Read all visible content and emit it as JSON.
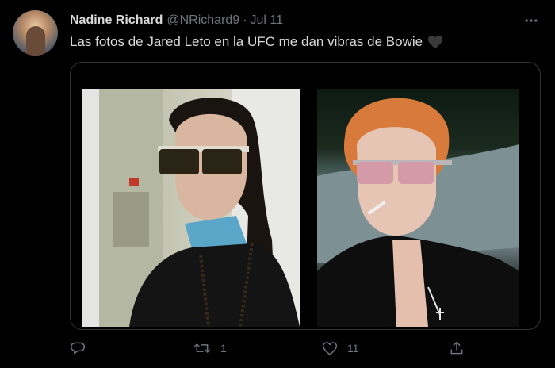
{
  "tweet": {
    "author_name": "Nadine Richard",
    "handle": "@NRichard9",
    "separator": "·",
    "time": "Jul 11",
    "text": "Las fotos de Jared Leto en la UFC me dan vibras de Bowie",
    "emoji_icon": "black-heart-icon"
  },
  "actions": {
    "reply": {
      "icon": "reply-icon",
      "count": ""
    },
    "retweet": {
      "icon": "retweet-icon",
      "count": "1"
    },
    "like": {
      "icon": "heart-icon",
      "count": "11"
    },
    "share": {
      "icon": "share-icon",
      "count": ""
    }
  },
  "colors": {
    "background": "#000000",
    "text": "#d9d9d9",
    "muted": "#6e767d",
    "border": "#2f3336"
  }
}
